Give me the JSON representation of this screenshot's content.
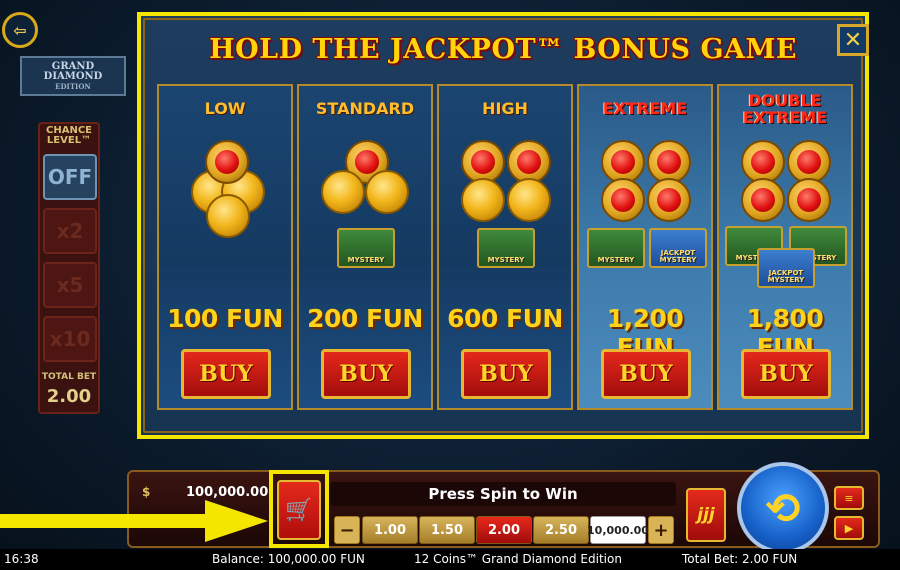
{
  "left_panel": {
    "logo_title": "GRAND DIAMOND",
    "logo_sub": "EDITION",
    "chance_title": "CHANCE LEVEL™",
    "chance_options": [
      "OFF",
      "x2",
      "x5",
      "x10"
    ],
    "total_bet_label": "TOTAL BET",
    "total_bet_value": "2.00"
  },
  "popup": {
    "title": "HOLD THE JACKPOT™ BONUS GAME",
    "close_label": "✕",
    "columns": [
      {
        "label": "LOW",
        "price": "100 FUN",
        "buy": "BUY",
        "chests": []
      },
      {
        "label": "STANDARD",
        "price": "200 FUN",
        "buy": "BUY",
        "chests": [
          "MYSTERY"
        ]
      },
      {
        "label": "HIGH",
        "price": "600 FUN",
        "buy": "BUY",
        "chests": [
          "MYSTERY"
        ]
      },
      {
        "label": "EXTREME",
        "price": "1,200 FUN",
        "buy": "BUY",
        "chests": [
          "MYSTERY",
          "JACKPOT MYSTERY"
        ]
      },
      {
        "label": "DOUBLE EXTREME",
        "price": "1,800 FUN",
        "buy": "BUY",
        "chests": [
          "MYSTERY",
          "MYSTERY",
          "JACKPOT MYSTERY"
        ]
      }
    ]
  },
  "bottom_bar": {
    "balance_value": "100,000.00",
    "status_message": "Press Spin to Win",
    "bet_options": [
      "1.00",
      "1.50",
      "2.00",
      "2.50",
      "10,000.00"
    ],
    "selected_bet": "2.00",
    "minus_label": "−",
    "plus_label": "+",
    "autoplay_label": "jjj"
  },
  "status_line": {
    "time": "16:38",
    "balance": "Balance: 100,000.00 FUN",
    "game_name": "12 Coins™ Grand Diamond Edition",
    "total_bet": "Total Bet: 2.00 FUN"
  },
  "colors": {
    "highlight": "#f5e600",
    "title_gold": "#ffd40a",
    "buy_red": "#d01a12",
    "spin_blue": "#1660c8"
  }
}
